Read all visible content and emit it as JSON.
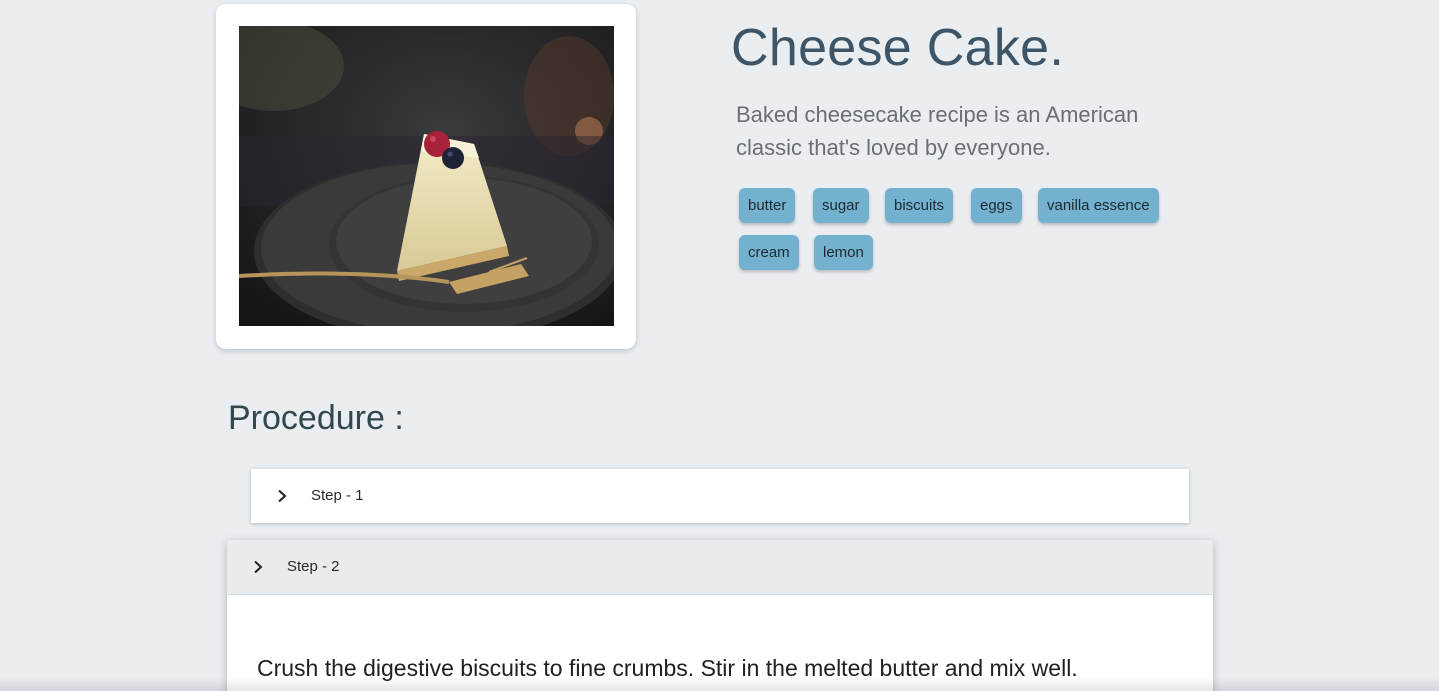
{
  "recipe": {
    "title": "Cheese Cake.",
    "description": "Baked cheesecake recipe is an American classic that's loved by everyone.",
    "image_alt": "Slice of baked cheesecake with berries on a dark plate",
    "ingredients": [
      "butter",
      "sugar",
      "biscuits",
      "eggs",
      "vanilla essence",
      "cream",
      "lemon"
    ]
  },
  "procedure": {
    "heading": "Procedure :",
    "steps": [
      {
        "label": "Step - 1",
        "expanded": false,
        "icon": "chevron-right-icon"
      },
      {
        "label": "Step - 2",
        "expanded": true,
        "icon": "chevron-right-icon",
        "text": "Crush the digestive biscuits to fine crumbs. Stir in the melted butter and mix well."
      }
    ]
  },
  "colors": {
    "background": "#eaeef1",
    "chip": "#74b1cf",
    "title": "#3d5566"
  }
}
